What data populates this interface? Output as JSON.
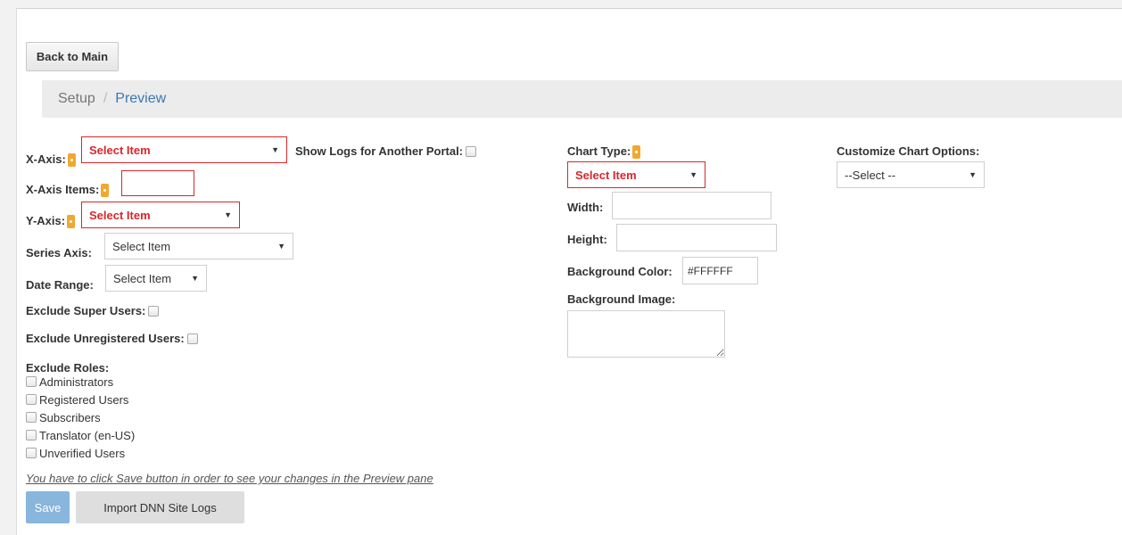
{
  "nav": {
    "back_label": "Back to Main"
  },
  "breadcrumb": {
    "items": [
      "Setup",
      "Preview"
    ],
    "separator": "/"
  },
  "left": {
    "x_axis": {
      "label": "X-Axis:",
      "value": "Select Item"
    },
    "x_axis_items": {
      "label": "X-Axis Items:",
      "value": ""
    },
    "y_axis": {
      "label": "Y-Axis:",
      "value": "Select Item"
    },
    "series_axis": {
      "label": "Series Axis:",
      "value": "Select Item"
    },
    "date_range": {
      "label": "Date Range:",
      "value": "Select Item"
    },
    "exclude_super": {
      "label": "Exclude Super Users:"
    },
    "exclude_unregistered": {
      "label": "Exclude Unregistered Users:"
    },
    "exclude_roles": {
      "label": "Exclude Roles:",
      "roles": [
        "Administrators",
        "Registered Users",
        "Subscribers",
        "Translator (en-US)",
        "Unverified Users"
      ]
    },
    "note": "You have to click Save button in order to see your changes in the Preview pane"
  },
  "show_logs": {
    "label": "Show Logs for Another Portal:"
  },
  "chart": {
    "type": {
      "label": "Chart Type:",
      "value": "Select Item"
    },
    "width": {
      "label": "Width:",
      "value": ""
    },
    "height": {
      "label": "Height:",
      "value": ""
    },
    "bg_color": {
      "label": "Background Color:",
      "value": "#FFFFFF"
    },
    "bg_image": {
      "label": "Background Image:"
    }
  },
  "customize": {
    "label": "Customize Chart Options:",
    "value": "--Select --"
  },
  "actions": {
    "save_label": "Save",
    "import_label": "Import DNN Site Logs"
  },
  "colors": {
    "required": "#f0a830",
    "error_border": "#d9262c",
    "link": "#3a7ab0",
    "save_bg": "#88b6dc"
  }
}
